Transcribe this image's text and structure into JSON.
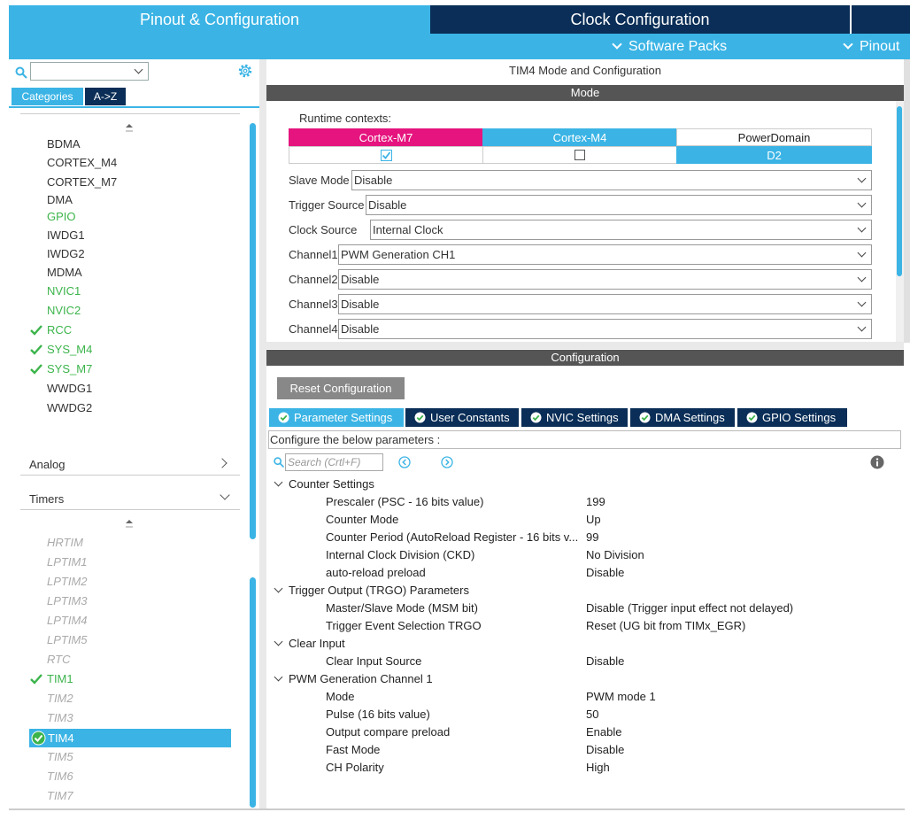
{
  "top_tabs": {
    "pinout": "Pinout & Configuration",
    "clock": "Clock Configuration"
  },
  "subbar": {
    "software_packs": "Software Packs",
    "pinout": "Pinout"
  },
  "left": {
    "category_tab": "Categories",
    "az_tab": "A->Z",
    "system_items": [
      "BDMA",
      "CORTEX_M4",
      "CORTEX_M7",
      "DMA",
      "GPIO",
      "IWDG1",
      "IWDG2",
      "MDMA",
      "NVIC1",
      "NVIC2",
      "RCC",
      "SYS_M4",
      "SYS_M7",
      "WWDG1",
      "WWDG2"
    ],
    "analog": "Analog",
    "timers": "Timers",
    "timer_items": [
      "HRTIM",
      "LPTIM1",
      "LPTIM2",
      "LPTIM3",
      "LPTIM4",
      "LPTIM5",
      "RTC",
      "TIM1",
      "TIM2",
      "TIM3",
      "TIM4",
      "TIM5",
      "TIM6",
      "TIM7"
    ]
  },
  "mode": {
    "title": "TIM4 Mode and Configuration",
    "bar": "Mode",
    "runtime_label": "Runtime contexts:",
    "contexts": [
      "Cortex-M7",
      "Cortex-M4",
      "PowerDomain"
    ],
    "power_domain_value": "D2",
    "fields": [
      {
        "label": "Slave Mode",
        "value": "Disable"
      },
      {
        "label": "Trigger Source",
        "value": "Disable"
      },
      {
        "label": "Clock Source",
        "value": "Internal Clock"
      },
      {
        "label": "Channel1",
        "value": "PWM Generation CH1"
      },
      {
        "label": "Channel2",
        "value": "Disable"
      },
      {
        "label": "Channel3",
        "value": "Disable"
      },
      {
        "label": "Channel4",
        "value": "Disable"
      }
    ]
  },
  "config": {
    "bar": "Configuration",
    "reset": "Reset Configuration",
    "tabs": [
      "Parameter Settings",
      "User Constants",
      "NVIC Settings",
      "DMA Settings",
      "GPIO Settings"
    ],
    "configure_text": "Configure the below parameters :",
    "search_placeholder": "Search (Crtl+F)",
    "groups": [
      {
        "name": "Counter Settings",
        "params": [
          {
            "name": "Prescaler (PSC - 16 bits value)",
            "value": "199"
          },
          {
            "name": "Counter Mode",
            "value": "Up"
          },
          {
            "name": "Counter Period (AutoReload Register - 16 bits v...",
            "value": "99"
          },
          {
            "name": "Internal Clock Division (CKD)",
            "value": "No Division"
          },
          {
            "name": "auto-reload preload",
            "value": "Disable"
          }
        ]
      },
      {
        "name": "Trigger Output (TRGO) Parameters",
        "params": [
          {
            "name": "Master/Slave Mode (MSM bit)",
            "value": "Disable (Trigger input effect not delayed)"
          },
          {
            "name": "Trigger Event Selection TRGO",
            "value": "Reset (UG bit from TIMx_EGR)"
          }
        ]
      },
      {
        "name": "Clear Input",
        "params": [
          {
            "name": "Clear Input Source",
            "value": "Disable"
          }
        ]
      },
      {
        "name": "PWM Generation Channel 1",
        "params": [
          {
            "name": "Mode",
            "value": "PWM mode 1"
          },
          {
            "name": "Pulse (16 bits value)",
            "value": "50"
          },
          {
            "name": "Output compare preload",
            "value": "Enable"
          },
          {
            "name": "Fast Mode",
            "value": "Disable"
          },
          {
            "name": "CH Polarity",
            "value": "High"
          }
        ]
      }
    ]
  },
  "colors": {
    "accent": "#3bb4e5",
    "navy": "#0a2e57",
    "cortex_m7": "#e5147e",
    "green": "#3cb44b"
  }
}
